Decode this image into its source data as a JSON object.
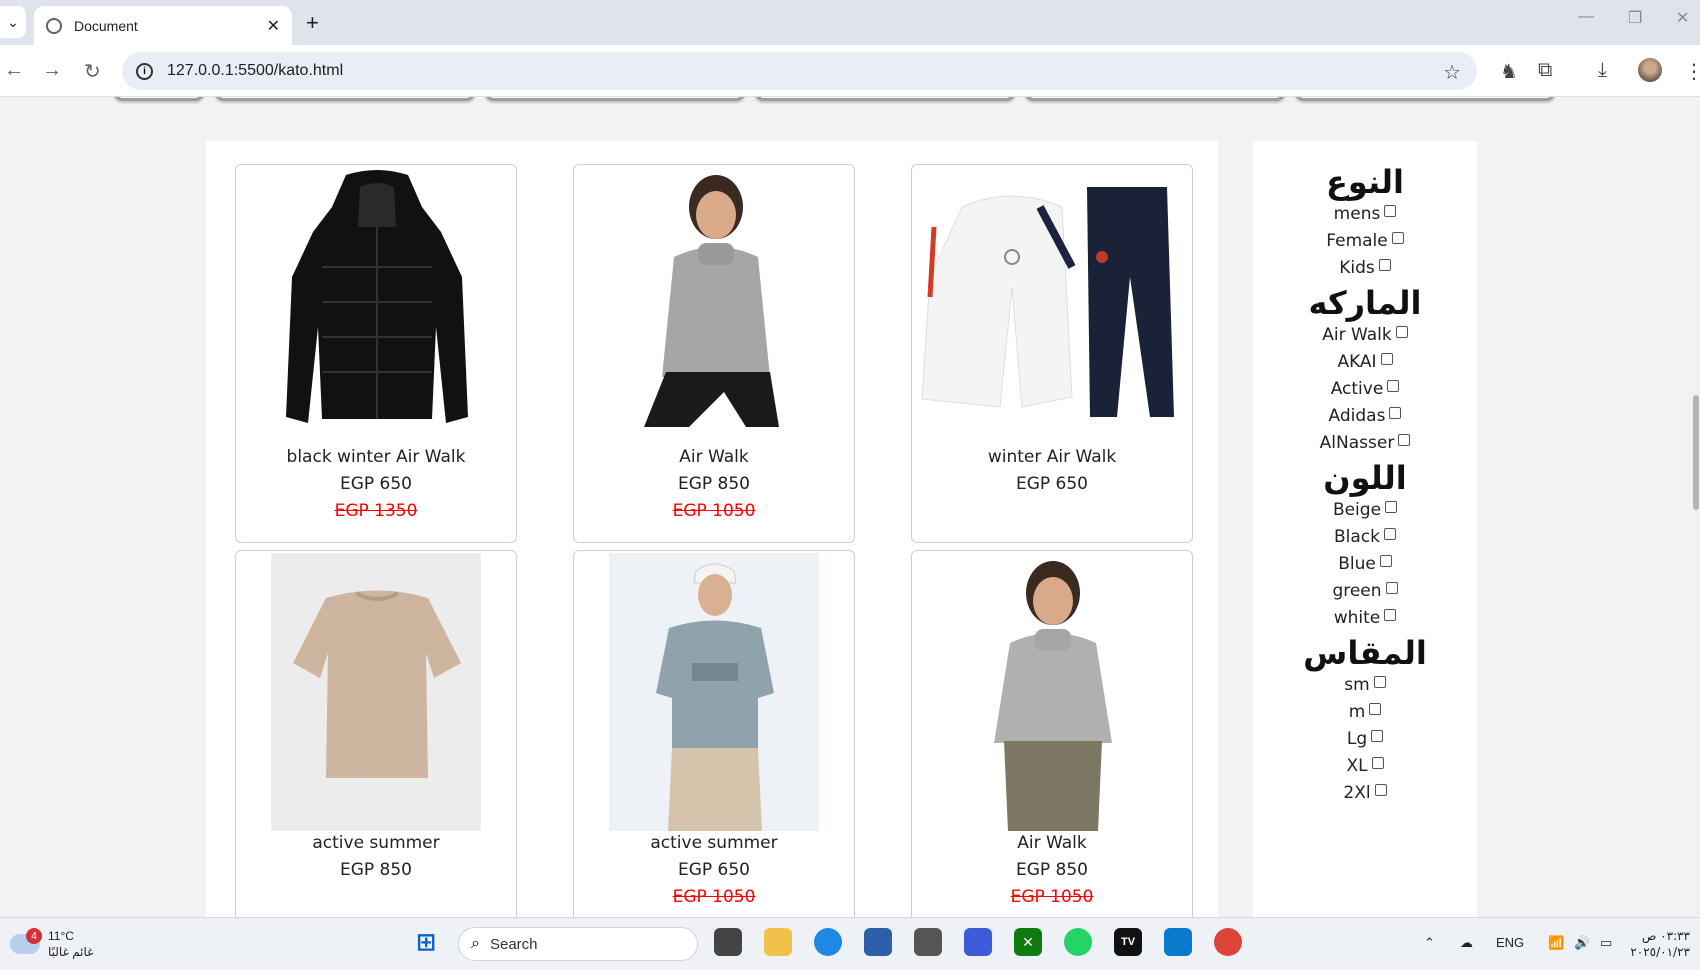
{
  "browser": {
    "tab_title": "Document",
    "url": "127.0.0.1:5500/kato.html"
  },
  "products": [
    {
      "name": "black winter Air Walk",
      "price": "EGP 650",
      "old_price": "EGP 1350",
      "image": "black puffer jacket"
    },
    {
      "name": "Air Walk",
      "price": "EGP 850",
      "old_price": "EGP 1050",
      "image": "boy in grey turtleneck"
    },
    {
      "name": "winter Air Walk",
      "price": "EGP 650",
      "old_price": "",
      "image": "white tracksuit"
    },
    {
      "name": "active summer",
      "price": "EGP 850",
      "old_price": "",
      "image": "beige t-shirt"
    },
    {
      "name": "active summer",
      "price": "EGP 650",
      "old_price": "EGP 1050",
      "image": "man in grey t-shirt"
    },
    {
      "name": "Air Walk",
      "price": "EGP 850",
      "old_price": "EGP 1050",
      "image": "boy in grey sweater"
    }
  ],
  "filters": {
    "type": {
      "title": "النوع",
      "options": [
        "mens",
        "Female",
        "Kids"
      ]
    },
    "brand": {
      "title": "الماركه",
      "options": [
        "Air Walk",
        "AKAI",
        "Active",
        "Adidas",
        "AlNasser"
      ]
    },
    "color": {
      "title": "اللون",
      "options": [
        "Beige",
        "Black",
        "Blue",
        "green",
        "white"
      ]
    },
    "size": {
      "title": "المقاس",
      "options": [
        "sm",
        "m",
        "Lg",
        "XL",
        "2Xl"
      ]
    }
  },
  "taskbar": {
    "weather_temp": "11°C",
    "weather_desc": "غائم غالبًا",
    "weather_badge": "4",
    "search_label": "Search",
    "lang": "ENG",
    "time": "٠٣:٣٣ ص",
    "date": "٢٠٢٥/٠١/٢٣"
  },
  "colors": {
    "sale": "#ff0000",
    "page_bg": "#f2f2f2"
  }
}
